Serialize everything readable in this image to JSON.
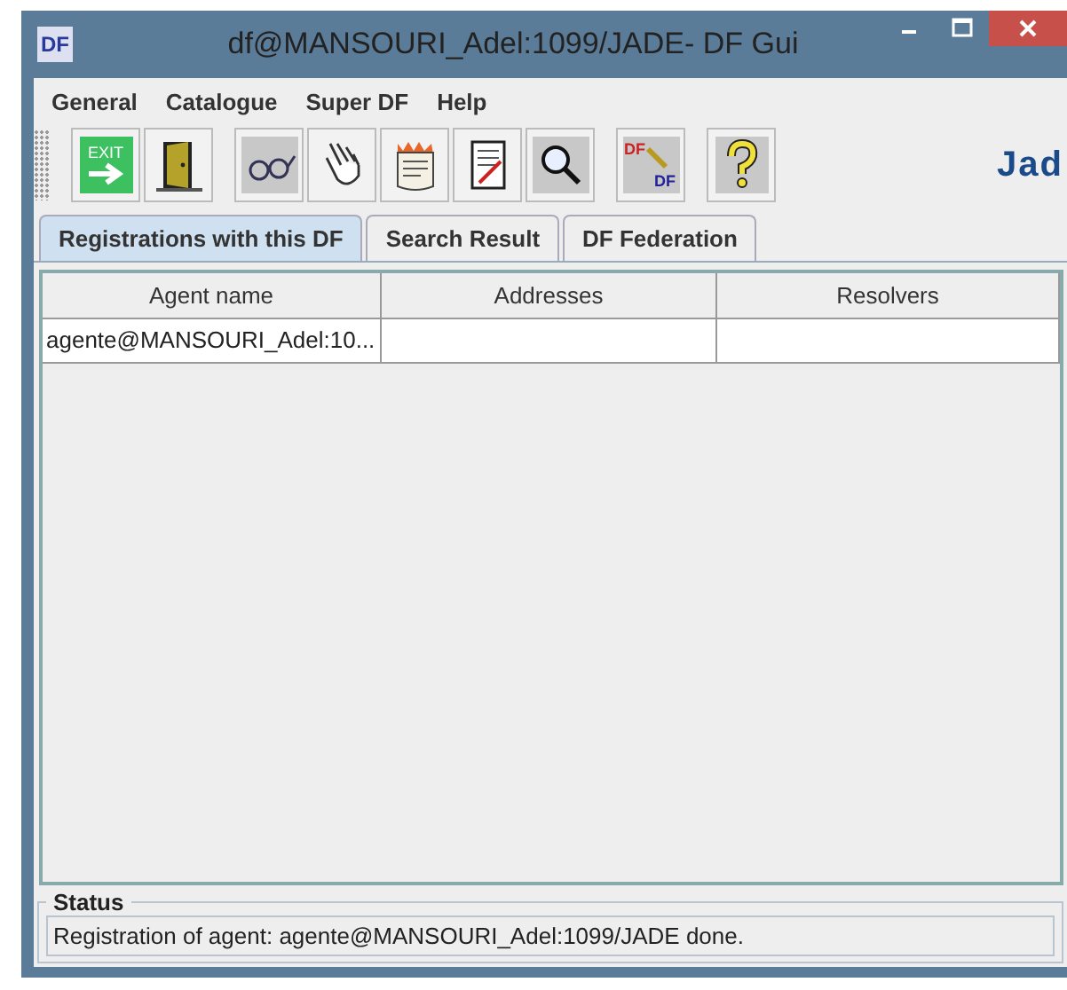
{
  "window": {
    "title": "df@MANSOURI_Adel:1099/JADE- DF Gui",
    "icon_text": "DF"
  },
  "menu": [
    "General",
    "Catalogue",
    "Super DF",
    "Help"
  ],
  "toolbar": {
    "groups": [
      [
        {
          "kind": "exit",
          "text": "EXIT"
        },
        {
          "kind": "door"
        }
      ],
      [
        {
          "kind": "glasses"
        },
        {
          "kind": "hand"
        },
        {
          "kind": "fire"
        },
        {
          "kind": "edit"
        },
        {
          "kind": "search"
        }
      ],
      [
        {
          "kind": "df",
          "text": "DF",
          "text2": "DF"
        }
      ],
      [
        {
          "kind": "help"
        }
      ]
    ],
    "logo": "Jad"
  },
  "tabs": [
    {
      "label": "Registrations with this DF",
      "selected": true
    },
    {
      "label": "Search Result",
      "selected": false
    },
    {
      "label": "DF Federation",
      "selected": false
    }
  ],
  "table": {
    "columns": [
      "Agent name",
      "Addresses",
      "Resolvers"
    ],
    "rows": [
      [
        "agente@MANSOURI_Adel:10...",
        "",
        ""
      ]
    ]
  },
  "status": {
    "title": "Status",
    "text": "Registration of agent: agente@MANSOURI_Adel:1099/JADE done."
  }
}
